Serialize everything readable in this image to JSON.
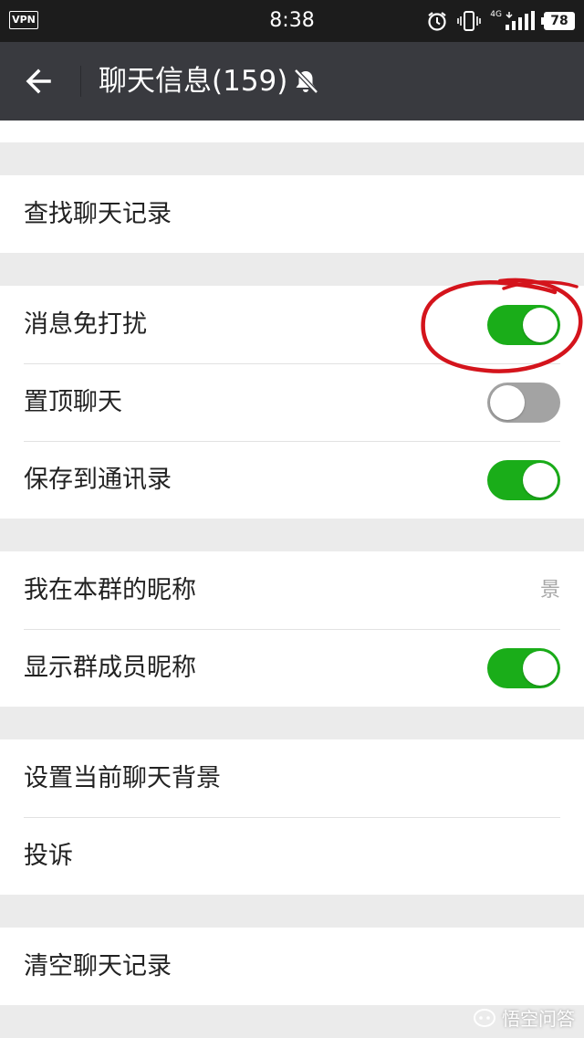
{
  "status_bar": {
    "vpn": "VPN",
    "time": "8:38",
    "network": "4G",
    "battery": "78"
  },
  "header": {
    "title": "聊天信息(159)"
  },
  "sections": {
    "search": {
      "label": "查找聊天记录"
    },
    "notifications": {
      "mute_label": "消息免打扰",
      "mute_on": true,
      "pin_label": "置顶聊天",
      "pin_on": false,
      "save_contacts_label": "保存到通讯录",
      "save_contacts_on": true
    },
    "nickname": {
      "my_nickname_label": "我在本群的昵称",
      "my_nickname_value": "景",
      "show_nicknames_label": "显示群成员昵称",
      "show_nicknames_on": true
    },
    "misc": {
      "background_label": "设置当前聊天背景",
      "report_label": "投诉"
    },
    "clear": {
      "label": "清空聊天记录"
    }
  },
  "colors": {
    "toggle_on": "#1aad19",
    "toggle_off": "#a3a3a3",
    "app_bar": "#393a3f",
    "annotation": "#d4141c"
  },
  "watermark": {
    "text": "悟空问答"
  }
}
